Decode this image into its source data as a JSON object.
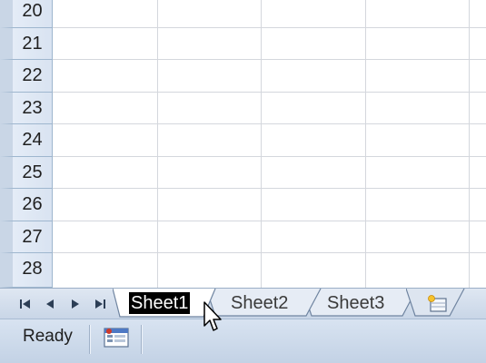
{
  "rows": [
    "20",
    "21",
    "22",
    "23",
    "24",
    "25",
    "26",
    "27",
    "28"
  ],
  "sheet_tabs": [
    {
      "label": "Sheet1",
      "selected": true
    },
    {
      "label": "Sheet2",
      "selected": false
    },
    {
      "label": "Sheet3",
      "selected": false
    }
  ],
  "new_sheet_icon": "insert-worksheet-icon",
  "nav_icons": [
    "first-sheet-icon",
    "previous-sheet-icon",
    "next-sheet-icon",
    "last-sheet-icon"
  ],
  "status": {
    "text": "Ready",
    "macro_icon": "record-macro-icon"
  },
  "colors": {
    "grid_line": "#d4d7dd",
    "header_bg": "#dce6f2",
    "selected_tab_label_bg": "#000000",
    "status_bar_bg": "#c9d7e8"
  }
}
